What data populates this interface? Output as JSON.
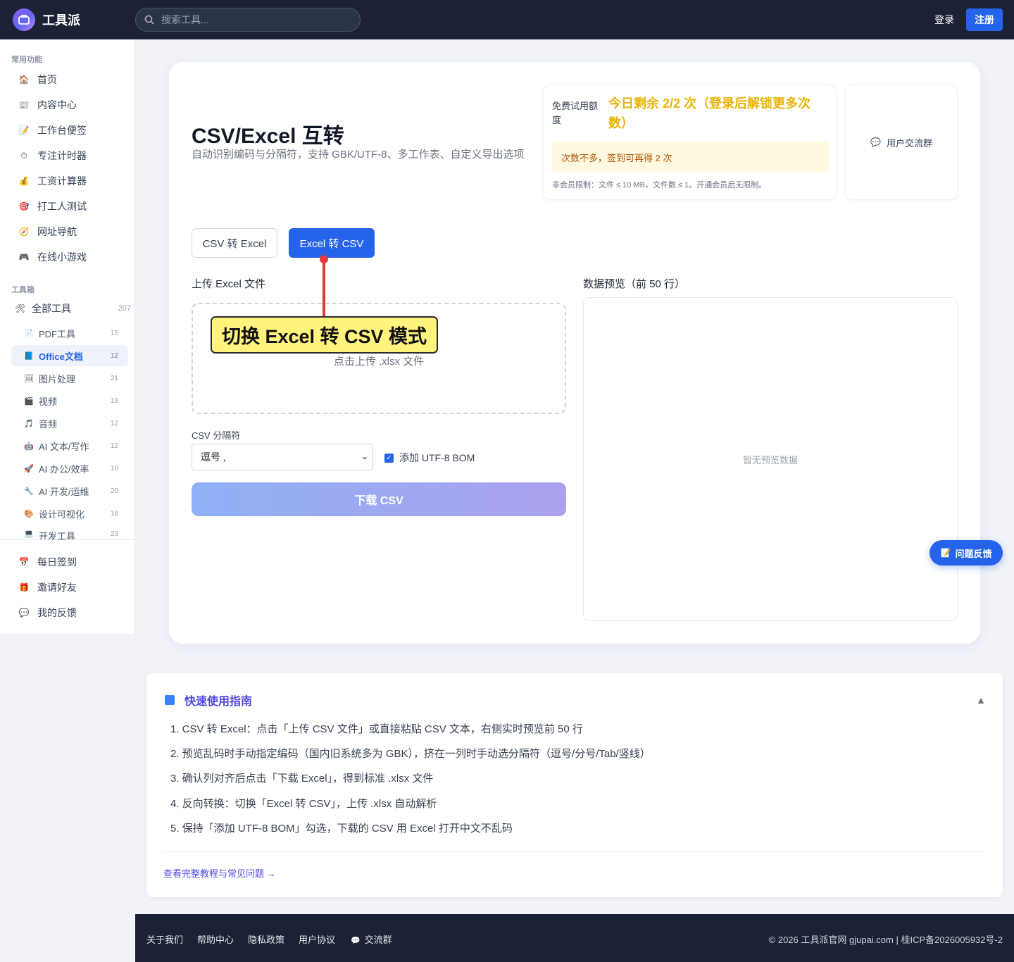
{
  "header": {
    "brand": "工具派",
    "search_placeholder": "搜索工具...",
    "login": "登录",
    "register": "注册"
  },
  "sidebar": {
    "section_common": "常用功能",
    "common_items": [
      {
        "label": "首页",
        "icon": "home-icon"
      },
      {
        "label": "内容中心",
        "icon": "newspaper-icon"
      },
      {
        "label": "工作台便签",
        "icon": "memo-icon"
      },
      {
        "label": "专注计时器",
        "icon": "timer-icon"
      },
      {
        "label": "工资计算器",
        "icon": "money-bag-icon"
      },
      {
        "label": "打工人测试",
        "icon": "target-icon"
      },
      {
        "label": "网址导航",
        "icon": "compass-icon"
      },
      {
        "label": "在线小游戏",
        "icon": "gamepad-icon"
      }
    ],
    "section_toolbox": "工具箱",
    "all_tools": {
      "label": "全部工具",
      "count": "207"
    },
    "tool_items": [
      {
        "label": "PDF工具",
        "count": "15"
      },
      {
        "label": "Office文档",
        "count": "12"
      },
      {
        "label": "图片处理",
        "count": "21"
      },
      {
        "label": "视频",
        "count": "18"
      },
      {
        "label": "音频",
        "count": "12"
      },
      {
        "label": "AI 文本/写作",
        "count": "12"
      },
      {
        "label": "AI 办公/效率",
        "count": "10"
      },
      {
        "label": "AI 开发/运维",
        "count": "20"
      },
      {
        "label": "设计可视化",
        "count": "18"
      },
      {
        "label": "开发工具",
        "count": "23"
      }
    ],
    "bottom_items": [
      {
        "label": "每日签到"
      },
      {
        "label": "邀请好友"
      },
      {
        "label": "我的反馈"
      }
    ]
  },
  "main": {
    "title": "CSV/Excel 互转",
    "subtitle": "自动识别编码与分隔符，支持 GBK/UTF-8、多工作表、自定义导出选项",
    "quota": {
      "label": "免费试用额度",
      "remaining": "今日剩余 2/2 次（登录后解锁更多次数）",
      "hint": "次数不多，签到可再得 2 次",
      "note": "非会员限制：文件 ≤ 10 MB，文件数 ≤ 1。开通会员后无限制。"
    },
    "group": "用户交流群",
    "tabs": {
      "csv_to_excel": "CSV 转 Excel",
      "excel_to_csv": "Excel 转 CSV"
    },
    "upload_label": "上传 Excel 文件",
    "upload_hint": "点击上传 .xlsx 文件",
    "separator_label": "CSV 分隔符",
    "separator_value": "逗号 ,",
    "bom_label": "添加 UTF-8 BOM",
    "download": "下载 CSV",
    "preview_label": "数据预览（前 50 行）",
    "preview_empty": "暂无预览数据"
  },
  "annotation": "切换 Excel 转 CSV 模式",
  "feedback_button": "问题反馈",
  "guide": {
    "title": "快速使用指南",
    "steps": [
      "1. CSV 转 Excel：点击「上传 CSV 文件」或直接粘贴 CSV 文本，右侧实时预览前 50 行",
      "2. 预览乱码时手动指定编码（国内旧系统多为 GBK），挤在一列时手动选分隔符（逗号/分号/Tab/竖线）",
      "3. 确认列对齐后点击「下载 Excel」，得到标准 .xlsx 文件",
      "4. 反向转换：切换「Excel 转 CSV」，上传 .xlsx 自动解析",
      "5. 保持「添加 UTF-8 BOM」勾选，下载的 CSV 用 Excel 打开中文不乱码"
    ],
    "link": "查看完整教程与常见问题 →"
  },
  "footer": {
    "links": [
      "关于我们",
      "帮助中心",
      "隐私政策",
      "用户协议",
      "交流群"
    ],
    "copyright": "© 2026 工具派官网 gjupai.com | 桂ICP备2026005932号-2"
  }
}
